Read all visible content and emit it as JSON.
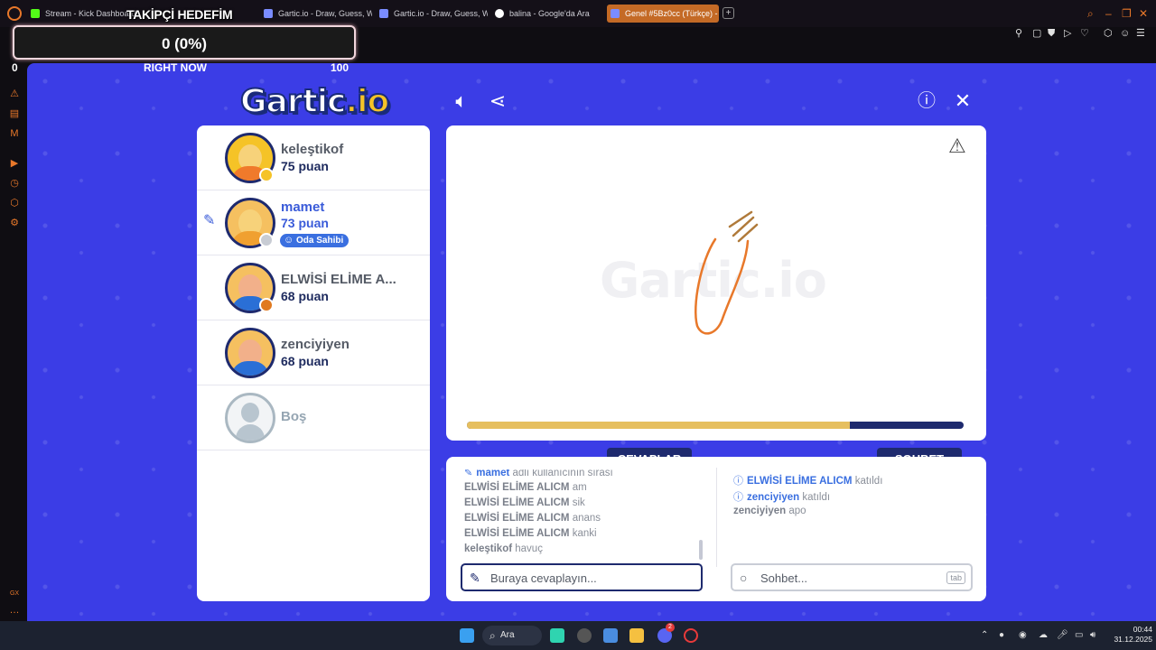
{
  "browser": {
    "tabs": [
      {
        "title": "Stream - Kick Dashboard",
        "fav_color": "#53fc18",
        "active": false
      },
      {
        "title": "Gartic.io - Draw, Guess, W",
        "fav_color": "#7a8cff",
        "active": false
      },
      {
        "title": "Gartic.io - Draw, Guess, W",
        "fav_color": "#7a8cff",
        "active": false
      },
      {
        "title": "balina - Google'da Ara",
        "fav_color": "#ffffff",
        "active": false
      },
      {
        "title": "Genel #5Bz0cc (Türkçe) -",
        "fav_color": "#7a8cff",
        "active": true
      }
    ],
    "new_tab": "+"
  },
  "overlay": {
    "title": "TAKİPÇİ HEDEFİM",
    "goal_text": "0 (0%)",
    "min_label": "0",
    "mid_label": "RIGHT NOW",
    "max_label": "100"
  },
  "game": {
    "logo_main": "Gartic",
    "logo_io": ".io",
    "players": [
      {
        "name": "keleştikof",
        "score": "75 puan",
        "dot_color": "#f5c327",
        "shirt": "#f07a2b",
        "hat": "#f5c327",
        "drawing": false
      },
      {
        "name": "mamet",
        "score": "73 puan",
        "dot_color": "#c8ccd4",
        "shirt": "#f0a030",
        "hat": "#f7d27a",
        "drawing": true,
        "badge": "Oda Sahibi"
      },
      {
        "name": "ELWİSİ ELİME A...",
        "score": "68 puan",
        "dot_color": "#e07a20",
        "shirt": "#2a6fd6",
        "hat": "#2a3a8a",
        "drawing": false
      },
      {
        "name": "zenciyiyen",
        "score": "68 puan",
        "dot_color": null,
        "shirt": "#2a6fd6",
        "hat": "#f07a2b",
        "drawing": false
      }
    ],
    "empty_slot": "Boş",
    "timer_fraction": 0.77,
    "sections": {
      "answers_title": "CEVAPLAR",
      "chat_title": "SOHBET"
    },
    "answers": [
      {
        "type": "sys",
        "user": "mamet",
        "text": "adlı kullanıcının sırası"
      },
      {
        "type": "msg",
        "user": "ELWİSİ ELİME ALICM",
        "text": "am"
      },
      {
        "type": "msg",
        "user": "ELWİSİ ELİME ALICM",
        "text": "sik"
      },
      {
        "type": "msg",
        "user": "ELWİSİ ELİME ALICM",
        "text": "anans"
      },
      {
        "type": "msg",
        "user": "ELWİSİ ELİME ALICM",
        "text": "kanki"
      },
      {
        "type": "msg",
        "user": "keleştikof",
        "text": "havuç"
      }
    ],
    "chat": [
      {
        "type": "sys",
        "user": "ELWİSİ ELİME ALICM",
        "text": "katıldı"
      },
      {
        "type": "sys",
        "user": "zenciyiyen",
        "text": "katıldı"
      },
      {
        "type": "msg",
        "user": "zenciyiyen",
        "text": "apo"
      }
    ],
    "answer_placeholder": "Buraya cevaplayın...",
    "chat_placeholder": "Sohbet...",
    "tab_key": "tab",
    "watermark": "Gartic.io"
  },
  "taskbar": {
    "search_label": "Ara",
    "discord_badge": "2",
    "time": "00:44",
    "date": "31.12.2025"
  },
  "colors": {
    "game_bg": "#3b3de6",
    "navy": "#1e2a6e",
    "accent_blue": "#3a6fe0",
    "timer_fill": "#e6bf5f",
    "brush_orange": "#e8782a",
    "brush_brown": "#b07a3a"
  }
}
